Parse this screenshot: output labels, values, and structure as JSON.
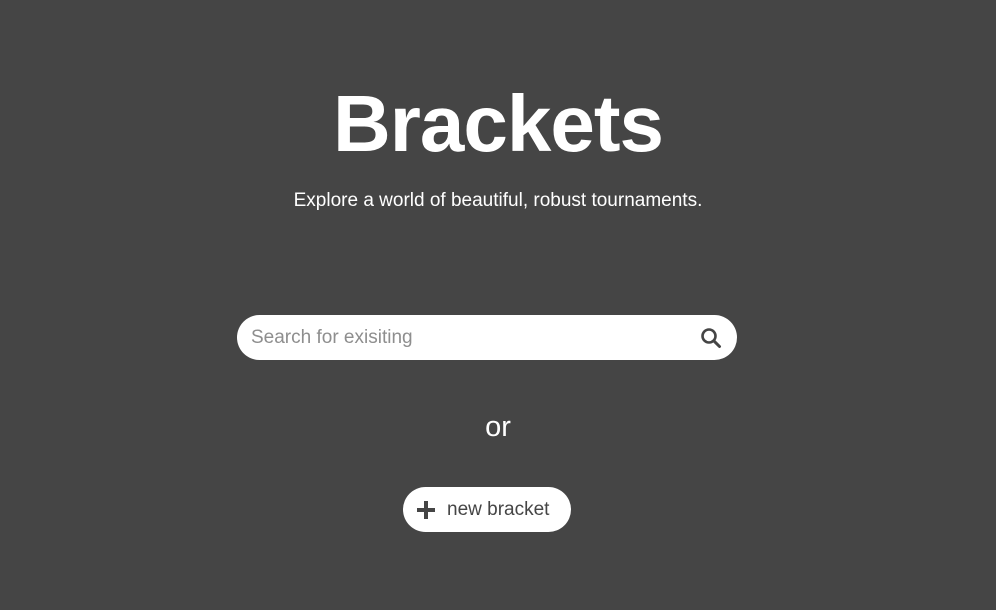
{
  "hero": {
    "title": "Brackets",
    "subtitle": "Explore a world of beautiful, robust tournaments."
  },
  "search": {
    "placeholder": "Search for exisiting",
    "value": "",
    "icon": "search-icon"
  },
  "divider": {
    "text": "or"
  },
  "new_bracket": {
    "label": "new bracket",
    "icon": "plus-icon"
  },
  "colors": {
    "background": "#454545",
    "foreground": "#ffffff",
    "placeholder": "#8e8e8e"
  }
}
